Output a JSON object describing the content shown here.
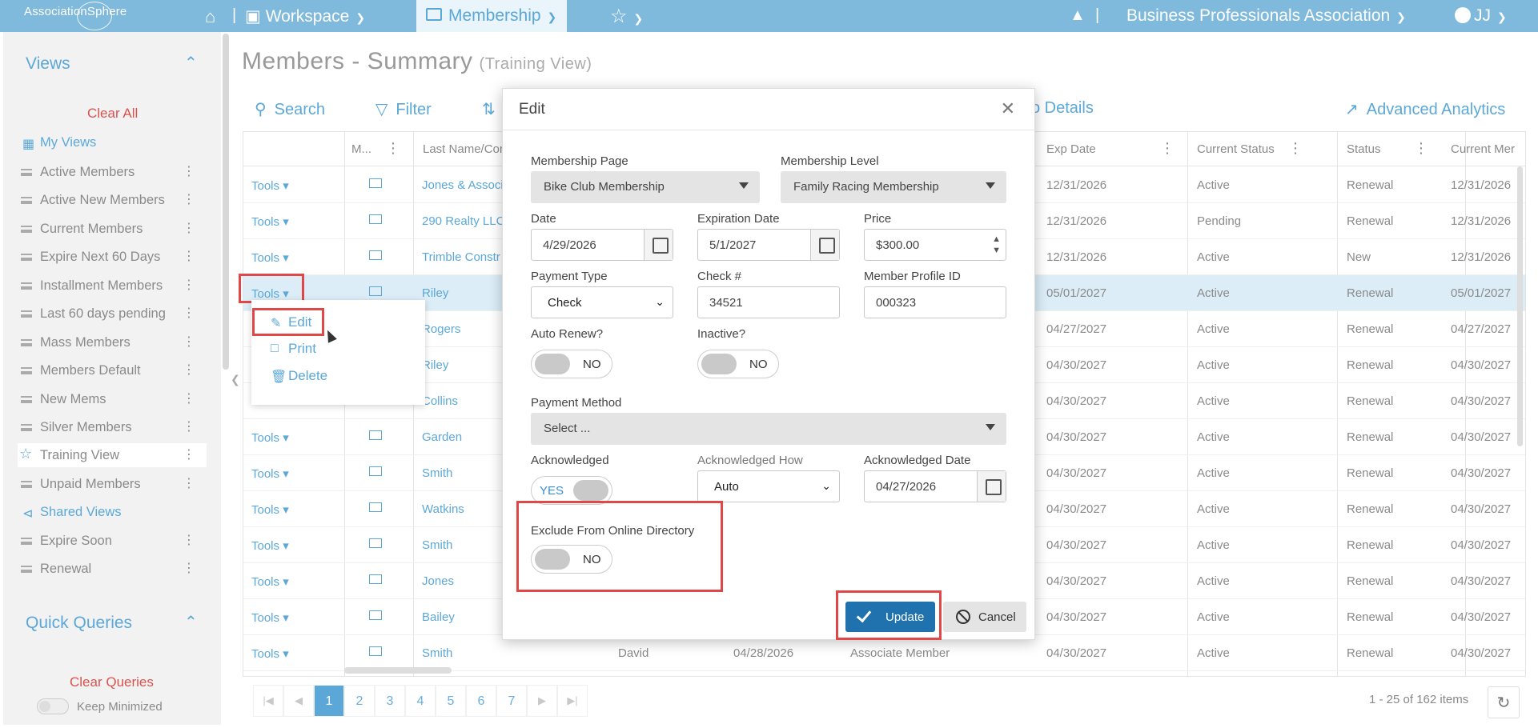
{
  "topbar": {
    "logo": "AssociationSphere",
    "workspace": "Workspace",
    "membership": "Membership",
    "org": "Business Professionals Association",
    "user": "JJ"
  },
  "sidebar": {
    "views_title": "Views",
    "clear_all": "Clear All",
    "my_views": "My Views",
    "items": [
      "Active Members",
      "Active New Members",
      "Current Members",
      "Expire Next 60 Days",
      "Installment Members",
      "Last 60 days pending",
      "Mass Members",
      "Members Default",
      "New Mems",
      "Silver Members",
      "Training View",
      "Unpaid Members"
    ],
    "shared_views": "Shared Views",
    "shared_items": [
      "Expire Soon",
      "Renewal"
    ],
    "quick_queries": "Quick Queries",
    "clear_queries": "Clear Queries",
    "keep_minimized": "Keep Minimized"
  },
  "page": {
    "title": "Members - Summary",
    "subtitle": "(Training View)",
    "search": "Search",
    "filter": "Filter",
    "details_partial": "o Details",
    "analytics": "Advanced Analytics"
  },
  "grid": {
    "headers": {
      "m": "M...",
      "last_name": "Last Name/Cor",
      "exp_date": "Exp Date",
      "current_status": "Current Status",
      "status": "Status",
      "current_mem": "Current Mer"
    },
    "tools_label": "Tools",
    "rows": [
      {
        "name": "Jones & Associ",
        "exp": "12/31/2026",
        "cur": "Active",
        "status": "Renewal",
        "cm": "12/31/2026"
      },
      {
        "name": "290 Realty LLC",
        "exp": "12/31/2026",
        "cur": "Pending",
        "status": "Renewal",
        "cm": "12/31/2026"
      },
      {
        "name": "Trimble Constr",
        "exp": "12/31/2026",
        "cur": "Active",
        "status": "New",
        "cm": "12/31/2026"
      },
      {
        "name": "Riley",
        "exp": "05/01/2027",
        "cur": "Active",
        "status": "Renewal",
        "cm": "05/01/2027"
      },
      {
        "name": "Rogers",
        "exp": "04/27/2027",
        "cur": "Active",
        "status": "Renewal",
        "cm": "04/27/2027"
      },
      {
        "name": "Riley",
        "exp": "04/30/2027",
        "cur": "Active",
        "status": "Renewal",
        "cm": "04/30/2027"
      },
      {
        "name": "Collins",
        "exp": "04/30/2027",
        "cur": "Active",
        "status": "Renewal",
        "cm": "04/30/2027"
      },
      {
        "name": "Garden",
        "exp": "04/30/2027",
        "cur": "Active",
        "status": "Renewal",
        "cm": "04/30/2027"
      },
      {
        "name": "Smith",
        "exp": "04/30/2027",
        "cur": "Active",
        "status": "Renewal",
        "cm": "04/30/2027"
      },
      {
        "name": "Watkins",
        "exp": "04/30/2027",
        "cur": "Active",
        "status": "Renewal",
        "cm": "04/30/2027"
      },
      {
        "name": "Smith",
        "exp": "04/30/2027",
        "cur": "Active",
        "status": "Renewal",
        "cm": "04/30/2027"
      },
      {
        "name": "Jones",
        "exp": "04/30/2027",
        "cur": "Active",
        "status": "Renewal",
        "cm": "04/30/2027"
      },
      {
        "name": "Bailey",
        "exp": "04/30/2027",
        "cur": "Active",
        "status": "Renewal",
        "cm": "04/30/2027"
      },
      {
        "name": "Smith",
        "first": "David",
        "date": "04/28/2026",
        "type": "Associate Member",
        "exp": "04/30/2027",
        "cur": "Active",
        "status": "Renewal",
        "cm": "04/30/2027"
      }
    ]
  },
  "tools_menu": {
    "edit": "Edit",
    "print": "Print",
    "delete": "Delete"
  },
  "modal": {
    "title": "Edit",
    "membership_page_label": "Membership Page",
    "membership_page": "Bike Club Membership",
    "membership_level_label": "Membership Level",
    "membership_level": "Family Racing Membership",
    "date_label": "Date",
    "date": "4/29/2026",
    "exp_label": "Expiration Date",
    "exp": "5/1/2027",
    "price_label": "Price",
    "price": "$300.00",
    "payment_type_label": "Payment Type",
    "payment_type": "Check",
    "check_label": "Check #",
    "check": "34521",
    "profile_label": "Member Profile ID",
    "profile": "000323",
    "auto_renew_label": "Auto Renew?",
    "auto_renew": "NO",
    "inactive_label": "Inactive?",
    "inactive": "NO",
    "payment_method_label": "Payment Method",
    "payment_method": "Select ...",
    "ack_label": "Acknowledged",
    "ack": "YES",
    "ack_how_label": "Acknowledged How",
    "ack_how": "Auto",
    "ack_date_label": "Acknowledged Date",
    "ack_date": "04/27/2026",
    "exclude_label": "Exclude From Online Directory",
    "exclude": "NO",
    "update": "Update",
    "cancel": "Cancel"
  },
  "pager": {
    "pages": [
      "1",
      "2",
      "3",
      "4",
      "5",
      "6",
      "7"
    ],
    "info": "1 - 25 of 162 items"
  }
}
